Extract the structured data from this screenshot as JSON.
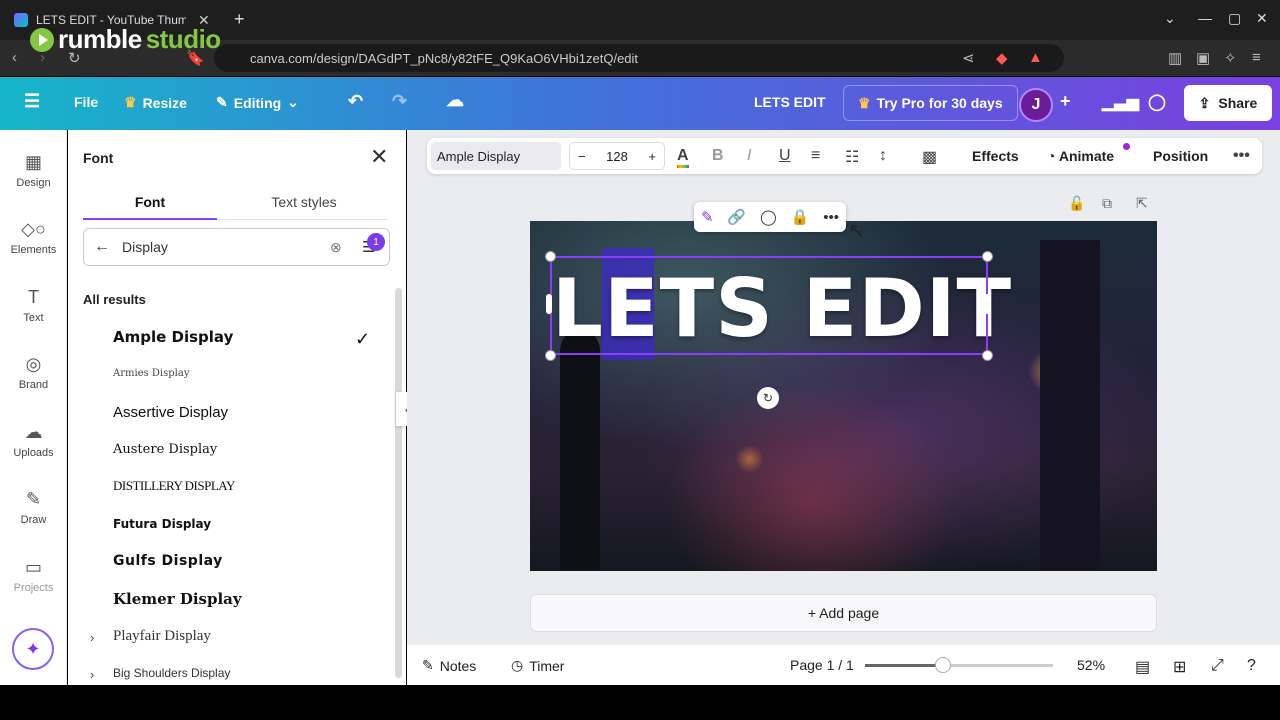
{
  "browser": {
    "tab_title": "LETS EDIT - YouTube Thumbn",
    "url": "canva.com/design/DAGdPT_pNc8/y82tFE_Q9KaO6VHbi1zetQ/edit"
  },
  "watermark": {
    "brand": "rumble",
    "suffix": "studio"
  },
  "topbar": {
    "file": "File",
    "resize": "Resize",
    "editing": "Editing",
    "design_name": "LETS EDIT",
    "try_pro": "Try Pro for 30 days",
    "avatar_letter": "J",
    "share": "Share"
  },
  "rail": [
    {
      "label": "Design",
      "icon": "design-icon"
    },
    {
      "label": "Elements",
      "icon": "elements-icon"
    },
    {
      "label": "Text",
      "icon": "text-icon"
    },
    {
      "label": "Brand",
      "icon": "brand-icon"
    },
    {
      "label": "Uploads",
      "icon": "uploads-icon"
    },
    {
      "label": "Draw",
      "icon": "draw-icon"
    },
    {
      "label": "Projects",
      "icon": "projects-icon"
    }
  ],
  "panel": {
    "title": "Font",
    "tabs": [
      "Font",
      "Text styles"
    ],
    "search_value": "Display",
    "filter_count": "1",
    "results_heading": "All results",
    "fonts": [
      "Ample Display",
      "Armies Display",
      "Assertive Display",
      "Austere Display",
      "DISTILLERY DISPLAY",
      "Futura Display",
      "Gulfs Display",
      "Klemer Display",
      "Playfair Display",
      "Big Shoulders Display"
    ],
    "selected": "Ample Display"
  },
  "toolbar": {
    "font": "Ample Display",
    "size": "128",
    "effects": "Effects",
    "animate": "Animate",
    "position": "Position"
  },
  "canvas": {
    "text": "LETS EDIT"
  },
  "footer": {
    "add_page": "+ Add page",
    "notes": "Notes",
    "timer": "Timer",
    "page": "Page 1 / 1",
    "zoom": "52%",
    "zoom_value": 52
  },
  "colors": {
    "accent": "#8b3dff",
    "highlight": "#3c28c8"
  }
}
